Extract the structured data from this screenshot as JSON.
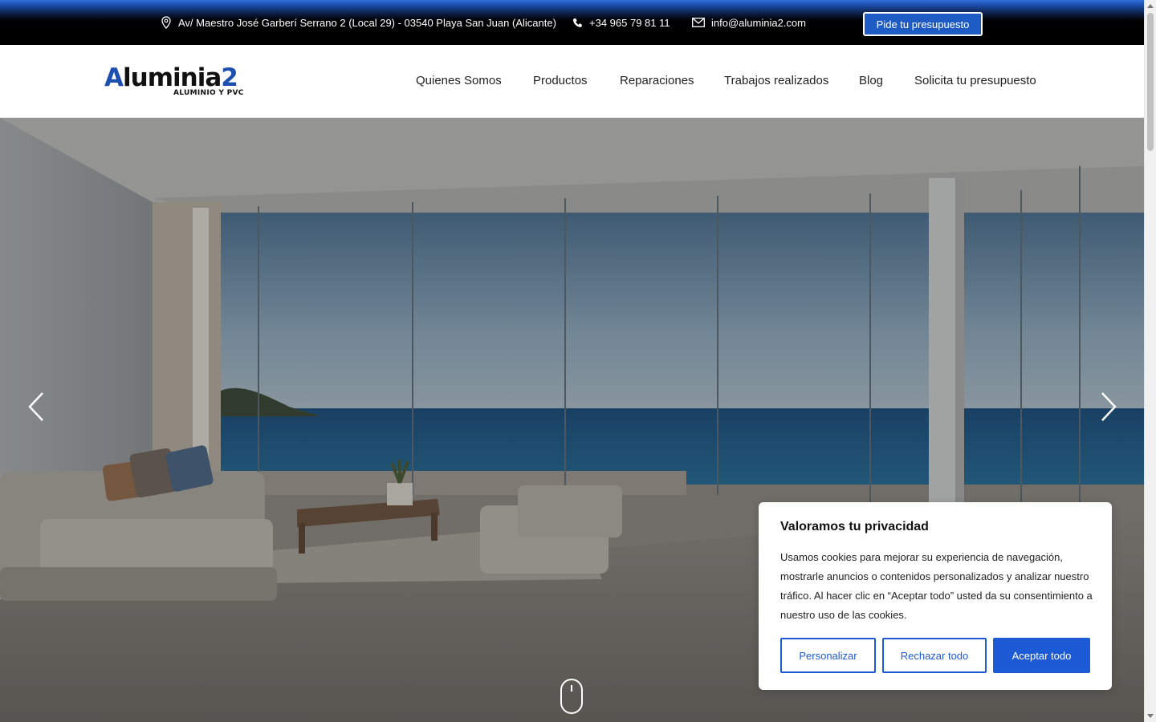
{
  "topbar": {
    "address": "Av/ Maestro José Garberí Serrano 2 (Local 29) - 03540 Playa San Juan (Alicante)",
    "phone": "+34 965 79 81 11",
    "email": "info@aluminia2.com",
    "cta": "Pide tu presupuesto"
  },
  "logo": {
    "brand_a": "A",
    "brand_rest": "luminia",
    "brand_num": "2",
    "tagline": "ALUMINIO Y PVC"
  },
  "nav": {
    "items": [
      {
        "label": "Quienes Somos"
      },
      {
        "label": "Productos"
      },
      {
        "label": "Reparaciones"
      },
      {
        "label": "Trabajos realizados"
      },
      {
        "label": "Blog"
      },
      {
        "label": "Solicita tu presupuesto"
      }
    ]
  },
  "hero": {
    "icons": [
      "chevron-left-icon",
      "chevron-right-icon",
      "scroll-mouse-icon"
    ]
  },
  "cookie": {
    "title": "Valoramos tu privacidad",
    "text": "Usamos cookies para mejorar su experiencia de navegación, mostrarle anuncios o contenidos personalizados y analizar nuestro tráfico. Al hacer clic en “Aceptar todo” usted da su consentimiento a nuestro uso de las cookies.",
    "customize": "Personalizar",
    "reject": "Rechazar todo",
    "accept": "Aceptar todo"
  },
  "colors": {
    "brand_blue": "#1d4fb0",
    "accent_blue": "#1d5ad6",
    "topbar_bg": "#000000"
  }
}
